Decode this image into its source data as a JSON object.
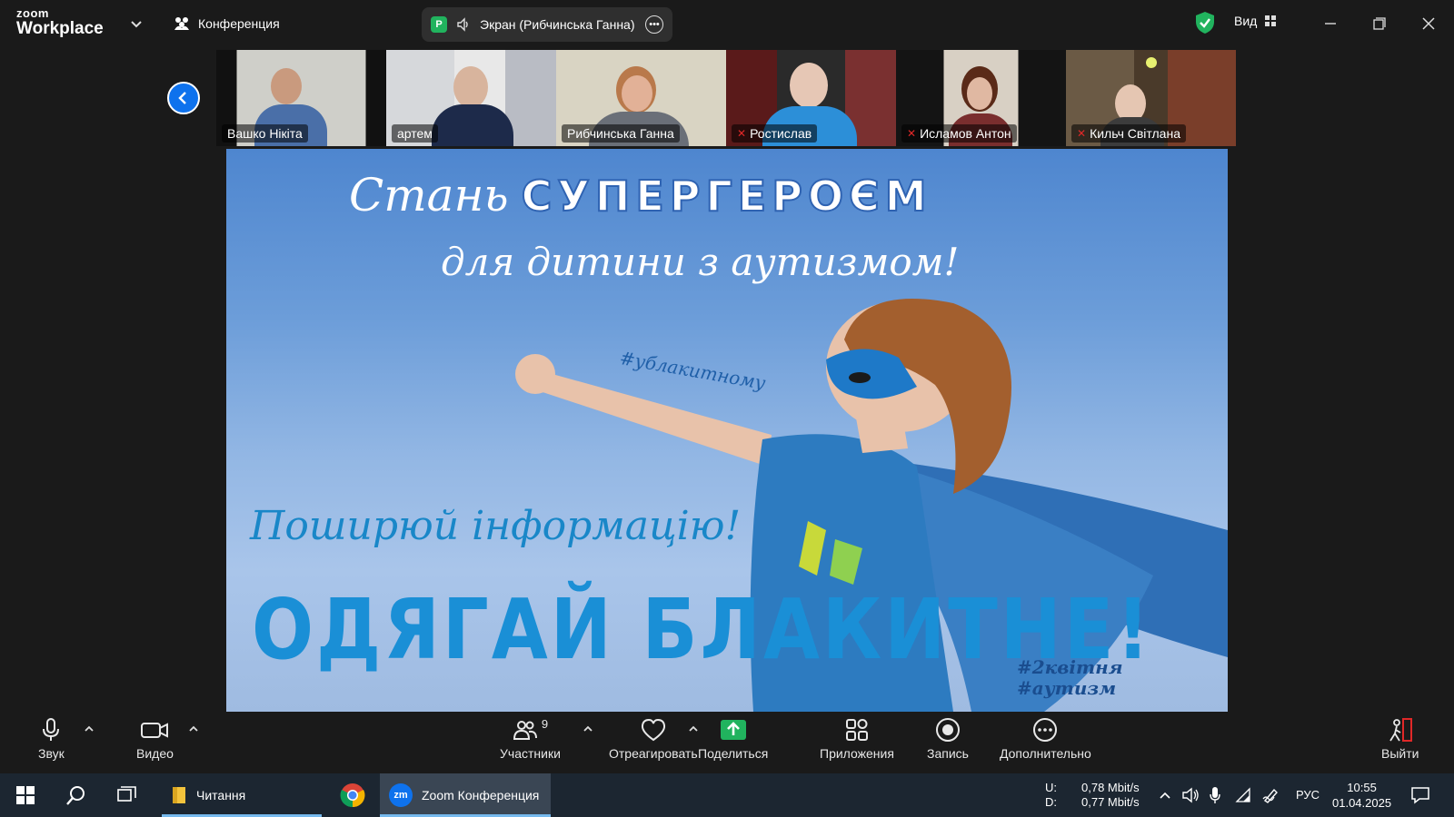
{
  "app": {
    "logo_small": "zoom",
    "logo_big": "Workplace",
    "meeting_label": "Конференция",
    "share_badge": "P",
    "share_label": "Экран (Рибчинська Ганна)",
    "view_label": "Вид"
  },
  "participants_strip": [
    {
      "name": "Вашко Нікіта",
      "muted": false
    },
    {
      "name": "артем",
      "muted": false
    },
    {
      "name": "Рибчинська Ганна",
      "muted": false
    },
    {
      "name": "Ростислав",
      "muted": true
    },
    {
      "name": "Исламов Антон",
      "muted": true
    },
    {
      "name": "Кильч  Світлана",
      "muted": true
    }
  ],
  "slide": {
    "line1_prefix": "Стань",
    "line1_bold": "СУПЕРГЕРОЄМ",
    "line2": "для дитини з аутизмом!",
    "hashtag_blue": "#ублакитному",
    "line3": "Поширюй інформацію!",
    "line4": "ОДЯГАЙ БЛАКИТНЕ!",
    "hashtag_bottom_1": "#2квітня",
    "hashtag_bottom_2": "#аутизм"
  },
  "toolbar": {
    "audio": "Звук",
    "video": "Видео",
    "participants": "Участники",
    "participants_count": "9",
    "react": "Отреагировать",
    "share": "Поделиться",
    "apps": "Приложения",
    "record": "Запись",
    "more": "Дополнительно",
    "leave": "Выйти"
  },
  "taskbar": {
    "explorer_label": "Читання",
    "zoom_label": "Zoom Конференция",
    "zoom_badge": "zm",
    "upload_label": "U:",
    "download_label": "D:",
    "upload_value": "0,78 Mbit/s",
    "download_value": "0,77 Mbit/s",
    "lang": "РУС",
    "time": "10:55",
    "date": "01.04.2025"
  },
  "colors": {
    "zoom_blue": "#0e72ed",
    "share_green": "#21b35e",
    "mute_red": "#e02828",
    "slide_blue": "#1a8fd6"
  }
}
